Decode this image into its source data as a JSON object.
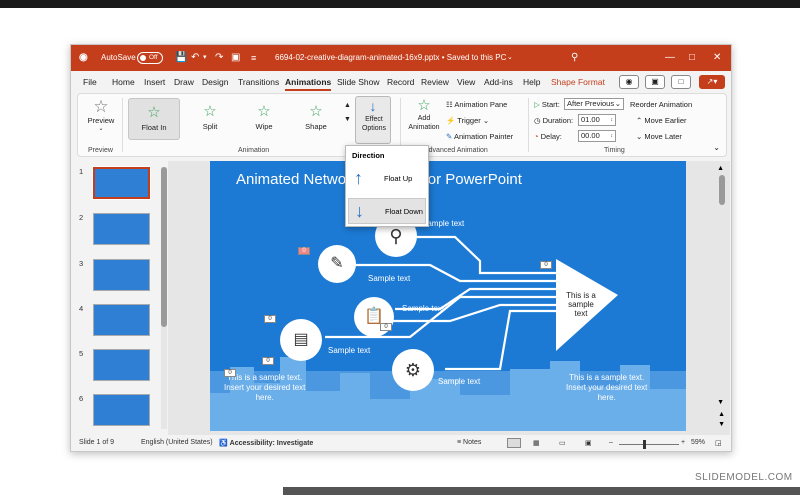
{
  "window": {
    "autosave_label": "AutoSave",
    "autosave_state": "Off",
    "file_title": "6694-02-creative-diagram-animated-16x9.pptx • Saved to this PC",
    "accent": "#c43e1c"
  },
  "menu": {
    "items": [
      "File",
      "Home",
      "Insert",
      "Draw",
      "Design",
      "Transitions",
      "Animations",
      "Slide Show",
      "Record",
      "Review",
      "View",
      "Add-ins",
      "Help",
      "Shape Format"
    ]
  },
  "ribbon": {
    "preview": "Preview",
    "preview_group": "Preview",
    "animations": [
      "Float In",
      "Split",
      "Wipe",
      "Shape"
    ],
    "animation_group": "Animation",
    "effect_options": "Effect Options",
    "add_animation": "Add Animation",
    "animation_pane": "Animation Pane",
    "trigger": "Trigger",
    "animation_painter": "Animation Painter",
    "advanced_group": "Advanced Animation",
    "start_label": "Start:",
    "start_value": "After Previous",
    "duration_label": "Duration:",
    "duration_value": "01.00",
    "delay_label": "Delay:",
    "delay_value": "00.00",
    "timing_group": "Timing",
    "reorder_title": "Reorder Animation",
    "move_earlier": "Move Earlier",
    "move_later": "Move Later"
  },
  "direction_menu": {
    "title": "Direction",
    "float_up": "Float Up",
    "float_down": "Float Down"
  },
  "slides": {
    "numbers": [
      "1",
      "2",
      "3",
      "4",
      "5",
      "6"
    ]
  },
  "slide": {
    "title": "Animated Network Diagram for PowerPoint",
    "sample_text": "Sample text",
    "center_text": "This is a sample text",
    "body_text_1": "This is a sample text.",
    "body_text_2": "Insert your desired text",
    "body_text_3": "here.",
    "tag_zero": "0"
  },
  "status": {
    "slide_info": "Slide 1 of 9",
    "language": "English (United States)",
    "accessibility": "Accessibility: Investigate",
    "notes": "Notes",
    "zoom": "59%"
  },
  "watermark": "SLIDEMODEL.COM"
}
